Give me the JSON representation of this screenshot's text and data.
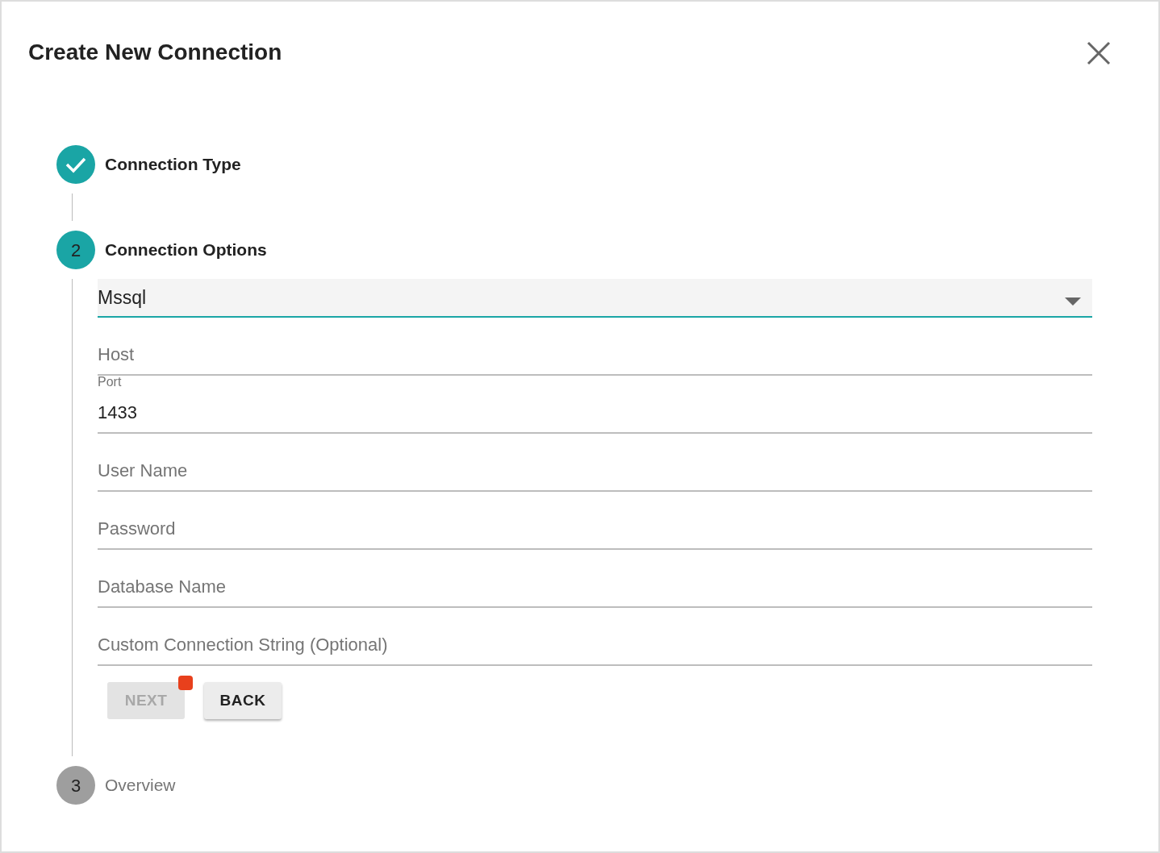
{
  "dialog": {
    "title": "Create New Connection"
  },
  "steps": [
    {
      "label": "Connection Type",
      "completed": true,
      "active": false
    },
    {
      "number": "2",
      "label": "Connection Options",
      "completed": false,
      "active": true
    },
    {
      "number": "3",
      "label": "Overview",
      "completed": false,
      "active": false
    }
  ],
  "connection_type": {
    "value": "Mssql"
  },
  "fields": [
    {
      "placeholder": "Host"
    },
    {
      "label": "Port",
      "value": "1433"
    },
    {
      "placeholder": "User Name"
    },
    {
      "placeholder": "Password"
    },
    {
      "placeholder": "Database Name"
    },
    {
      "placeholder": "Custom Connection String (Optional)"
    }
  ],
  "buttons": [
    {
      "label": "NEXT",
      "disabled": true,
      "notification_dot": true
    },
    {
      "label": "BACK",
      "disabled": false,
      "notification_dot": false
    }
  ]
}
